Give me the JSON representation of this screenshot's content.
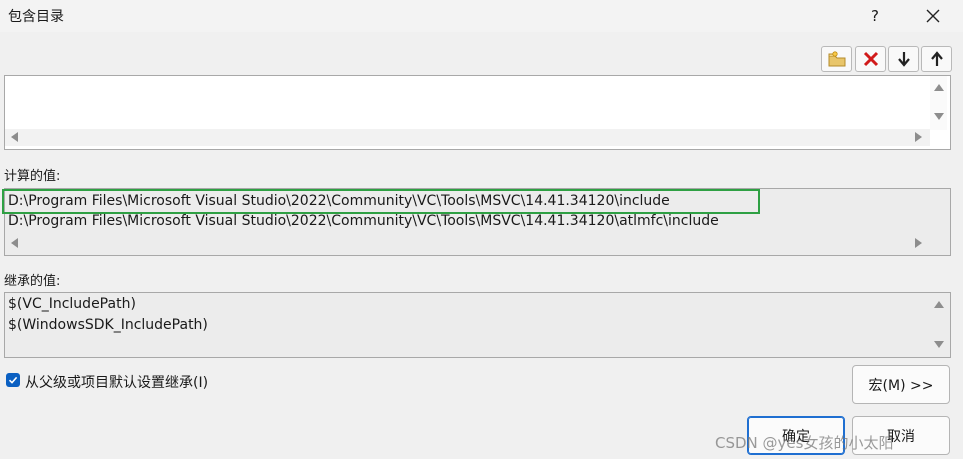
{
  "window": {
    "title": "包含目录",
    "help": "?",
    "close": "✕"
  },
  "toolbar": {
    "new_line_icon": "folder-new-icon",
    "delete_icon": "delete-icon",
    "move_down_icon": "arrow-down-icon",
    "move_up_icon": "arrow-up-icon"
  },
  "computed": {
    "label": "计算的值:",
    "lines": [
      "D:\\Program Files\\Microsoft Visual Studio\\2022\\Community\\VC\\Tools\\MSVC\\14.41.34120\\include",
      "D:\\Program Files\\Microsoft Visual Studio\\2022\\Community\\VC\\Tools\\MSVC\\14.41.34120\\atlmfc\\include"
    ],
    "highlight_color": "#2ea043"
  },
  "inherited": {
    "label": "继承的值:",
    "lines": [
      "$(VC_IncludePath)",
      "$(WindowsSDK_IncludePath)"
    ]
  },
  "inherit_checkbox": {
    "label": "从父级或项目默认设置继承(I)",
    "checked": true
  },
  "buttons": {
    "macros": "宏(M) >>",
    "ok": "确定",
    "cancel": "取消"
  },
  "watermark": "CSDN @yes女孩的小太阳",
  "colors": {
    "accent": "#0b60c2",
    "delete_red": "#d11a1a"
  }
}
